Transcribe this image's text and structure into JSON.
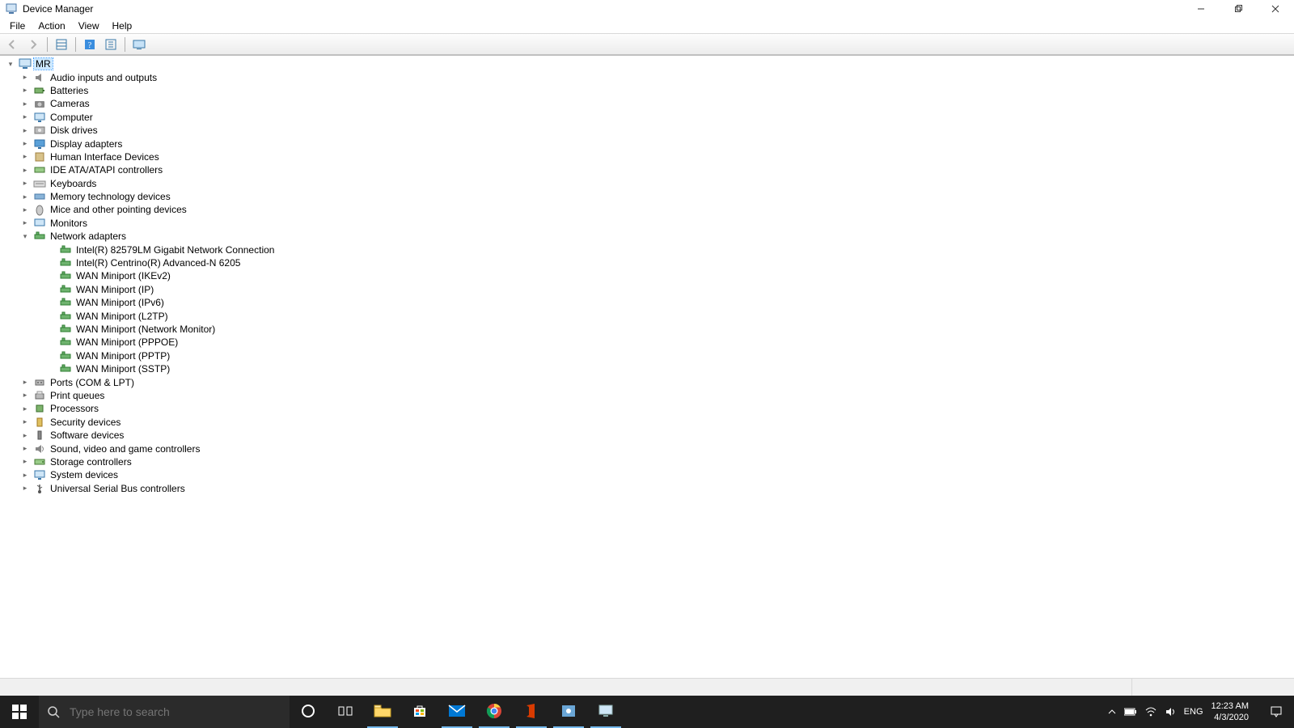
{
  "window": {
    "title": "Device Manager"
  },
  "menu": {
    "items": [
      "File",
      "Action",
      "View",
      "Help"
    ]
  },
  "toolbar": {
    "back_tip": "Back",
    "forward_tip": "Forward",
    "show_hidden_tip": "Show hidden devices",
    "help_tip": "Help",
    "properties_tip": "Properties",
    "scan_tip": "Scan for hardware changes"
  },
  "tree": {
    "root": {
      "label": "MR",
      "selected": true
    },
    "categories": [
      {
        "label": "Audio inputs and outputs",
        "icon": "audio",
        "expanded": false
      },
      {
        "label": "Batteries",
        "icon": "battery",
        "expanded": false
      },
      {
        "label": "Cameras",
        "icon": "camera",
        "expanded": false
      },
      {
        "label": "Computer",
        "icon": "computer",
        "expanded": false
      },
      {
        "label": "Disk drives",
        "icon": "disk",
        "expanded": false
      },
      {
        "label": "Display adapters",
        "icon": "display",
        "expanded": false
      },
      {
        "label": "Human Interface Devices",
        "icon": "hid",
        "expanded": false
      },
      {
        "label": "IDE ATA/ATAPI controllers",
        "icon": "ide",
        "expanded": false
      },
      {
        "label": "Keyboards",
        "icon": "keyboard",
        "expanded": false
      },
      {
        "label": "Memory technology devices",
        "icon": "memory",
        "expanded": false
      },
      {
        "label": "Mice and other pointing devices",
        "icon": "mouse",
        "expanded": false
      },
      {
        "label": "Monitors",
        "icon": "monitor",
        "expanded": false
      },
      {
        "label": "Network adapters",
        "icon": "network",
        "expanded": true,
        "children": [
          {
            "label": "Intel(R) 82579LM Gigabit Network Connection"
          },
          {
            "label": "Intel(R) Centrino(R) Advanced-N 6205"
          },
          {
            "label": "WAN Miniport (IKEv2)"
          },
          {
            "label": "WAN Miniport (IP)"
          },
          {
            "label": "WAN Miniport (IPv6)"
          },
          {
            "label": "WAN Miniport (L2TP)"
          },
          {
            "label": "WAN Miniport (Network Monitor)"
          },
          {
            "label": "WAN Miniport (PPPOE)"
          },
          {
            "label": "WAN Miniport (PPTP)"
          },
          {
            "label": "WAN Miniport (SSTP)"
          }
        ]
      },
      {
        "label": "Ports (COM & LPT)",
        "icon": "ports",
        "expanded": false
      },
      {
        "label": "Print queues",
        "icon": "printer",
        "expanded": false
      },
      {
        "label": "Processors",
        "icon": "cpu",
        "expanded": false
      },
      {
        "label": "Security devices",
        "icon": "security",
        "expanded": false
      },
      {
        "label": "Software devices",
        "icon": "software",
        "expanded": false
      },
      {
        "label": "Sound, video and game controllers",
        "icon": "sound",
        "expanded": false
      },
      {
        "label": "Storage controllers",
        "icon": "storage",
        "expanded": false
      },
      {
        "label": "System devices",
        "icon": "system",
        "expanded": false
      },
      {
        "label": "Universal Serial Bus controllers",
        "icon": "usb",
        "expanded": false
      }
    ]
  },
  "taskbar": {
    "search_placeholder": "Type here to search",
    "apps": [
      {
        "name": "cortana",
        "active": false
      },
      {
        "name": "task-view",
        "active": false
      },
      {
        "name": "file-explorer",
        "active": true
      },
      {
        "name": "microsoft-store",
        "active": false
      },
      {
        "name": "mail",
        "active": true
      },
      {
        "name": "chrome",
        "active": true
      },
      {
        "name": "office",
        "active": true
      },
      {
        "name": "settings-app",
        "active": true
      },
      {
        "name": "device-manager",
        "active": true
      }
    ],
    "tray": {
      "lang": "ENG",
      "time": "12:23 AM",
      "date": "4/3/2020"
    }
  }
}
